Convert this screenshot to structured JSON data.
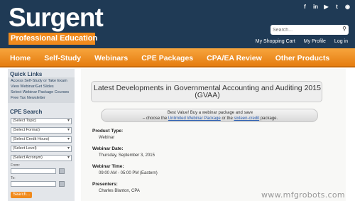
{
  "brand": {
    "name": "Surgent",
    "tagline": "Professional Education"
  },
  "social_icons": [
    "facebook-icon",
    "linkedin-icon",
    "youtube-icon",
    "twitter-icon",
    "feed-icon"
  ],
  "search": {
    "placeholder": "Search..."
  },
  "header_links": [
    "My Shopping Cart",
    "My Profile",
    "Log in"
  ],
  "nav": [
    "Home",
    "Self-Study",
    "Webinars",
    "CPE Packages",
    "CPA/EA Review",
    "Other Products"
  ],
  "sidebar": {
    "quick_links_title": "Quick Links",
    "quick_links": [
      "Access Self-Study or Take Exam",
      "View Webinar/Get Slides",
      "Select Webinar Package Courses",
      "Free Tax Newsletter"
    ],
    "cpe_search_title": "CPE Search",
    "selects": [
      "(Select Topic)",
      "(Select Format)",
      "(Select Credit Hours)",
      "(Select Level)",
      "(Select Acronym)"
    ],
    "from_label": "From:",
    "to_label": "To:",
    "search_button": "Search..."
  },
  "main": {
    "title": "Latest Developments in Governmental Accounting and Auditing 2015 (GVAA)",
    "banner_line1": "Best Value! Buy a webinar package and save",
    "banner_prefix": "– choose the",
    "banner_link1": "Unlimited Webinar Package",
    "banner_or": "or the",
    "banner_link2": "sixteen-credit",
    "banner_suffix": "package.",
    "fields": [
      {
        "label": "Product Type:",
        "value": "Webinar"
      },
      {
        "label": "Webinar Date:",
        "value": "Thursday, September 3, 2015"
      },
      {
        "label": "Webinar Time:",
        "value": "09:00 AM - 05:00 PM (Eastern)"
      },
      {
        "label": "Presenters:",
        "value": "Charles Blanton, CPA"
      }
    ]
  },
  "watermark": "www.mfgrobots.com",
  "colors": {
    "header": "#1f3a55",
    "accent": "#f08a1c",
    "link": "#2a5db0"
  }
}
